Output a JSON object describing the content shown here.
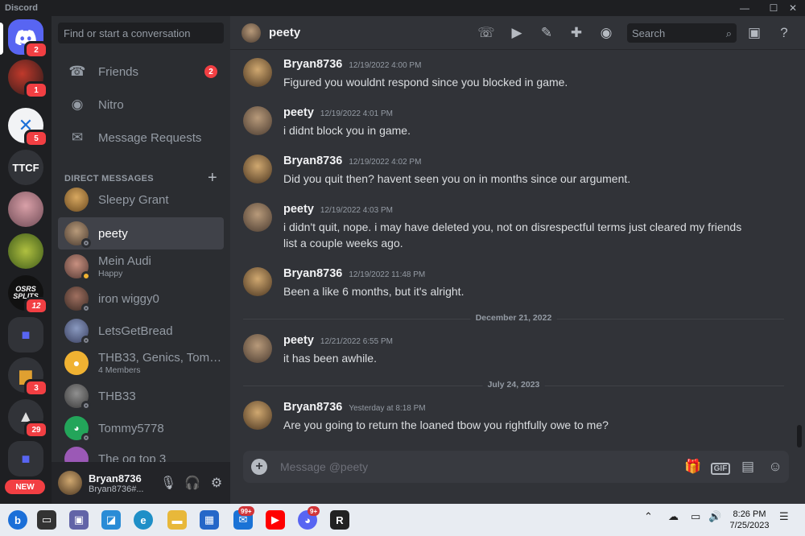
{
  "window": {
    "app_name": "Discord",
    "minimize": "—",
    "maximize": "☐",
    "close": "✕"
  },
  "servers": [
    {
      "name": "home",
      "badge": "2"
    },
    {
      "name": "server-red",
      "badge": "1"
    },
    {
      "name": "server-x",
      "badge": "5"
    },
    {
      "name": "TTCF",
      "label": "TTCF"
    },
    {
      "name": "server-pink"
    },
    {
      "name": "server-green"
    },
    {
      "name": "OSRS SPLITS",
      "label": "OSRS SPLITS",
      "badge": "12"
    },
    {
      "name": "folder-1"
    },
    {
      "name": "server-chest",
      "badge": "3"
    },
    {
      "name": "server-helmet",
      "badge": "29"
    },
    {
      "name": "folder-2"
    },
    {
      "name": "new-pill",
      "label": "NEW"
    }
  ],
  "sidebar": {
    "search_placeholder": "Find or start a conversation",
    "nav": [
      {
        "label": "Friends",
        "badge": "2"
      },
      {
        "label": "Nitro"
      },
      {
        "label": "Message Requests"
      }
    ],
    "dm_header": "DIRECT MESSAGES",
    "dms": [
      {
        "name": "Sleepy Grant",
        "sub": ""
      },
      {
        "name": "peety",
        "sub": ""
      },
      {
        "name": "Mein Audi",
        "sub": "Happy"
      },
      {
        "name": "iron wiggy0",
        "sub": ""
      },
      {
        "name": "LetsGetBread",
        "sub": ""
      },
      {
        "name": "THB33, Genics, Tomm...",
        "sub": "4 Members"
      },
      {
        "name": "THB33",
        "sub": ""
      },
      {
        "name": "Tommy5778",
        "sub": ""
      },
      {
        "name": "The og top 3",
        "sub": ""
      }
    ],
    "user": {
      "name": "Bryan8736",
      "tag": "Bryan8736#..."
    }
  },
  "chat": {
    "title": "peety",
    "search_placeholder": "Search",
    "composer_placeholder": "Message @peety",
    "messages": [
      {
        "author": "Bryan8736",
        "time": "12/19/2022 4:00 PM",
        "text": "Figured you wouldnt respond since you blocked in game."
      },
      {
        "author": "peety",
        "time": "12/19/2022 4:01 PM",
        "text": "i didnt block you in game."
      },
      {
        "author": "Bryan8736",
        "time": "12/19/2022 4:02 PM",
        "text": "Did you quit then? havent seen you on in months since our argument."
      },
      {
        "author": "peety",
        "time": "12/19/2022 4:03 PM",
        "text": "i didn't quit, nope. i may have deleted you, not on disrespectful terms just cleared my friends list a couple weeks ago."
      },
      {
        "author": "Bryan8736",
        "time": "12/19/2022 11:48 PM",
        "text": "Been a like 6 months, but it's alright."
      },
      {
        "author": "peety",
        "time": "12/21/2022 6:55 PM",
        "text": "it has been awhile."
      },
      {
        "author": "Bryan8736",
        "time": "Yesterday at 8:18 PM",
        "text": "Are you going to return the loaned tbow you rightfully owe to me?"
      }
    ],
    "dividers": [
      "December 21, 2022",
      "July 24, 2023"
    ]
  },
  "taskbar": {
    "mail_badge": "99+",
    "discord_badge": "9+",
    "time": "8:26 PM",
    "date": "7/25/2023"
  },
  "colors": {
    "blurple": "#5865f2",
    "red": "#f23f43",
    "chat_bg": "#313338",
    "sidebar_bg": "#2b2d31",
    "rail_bg": "#1e1f22"
  }
}
